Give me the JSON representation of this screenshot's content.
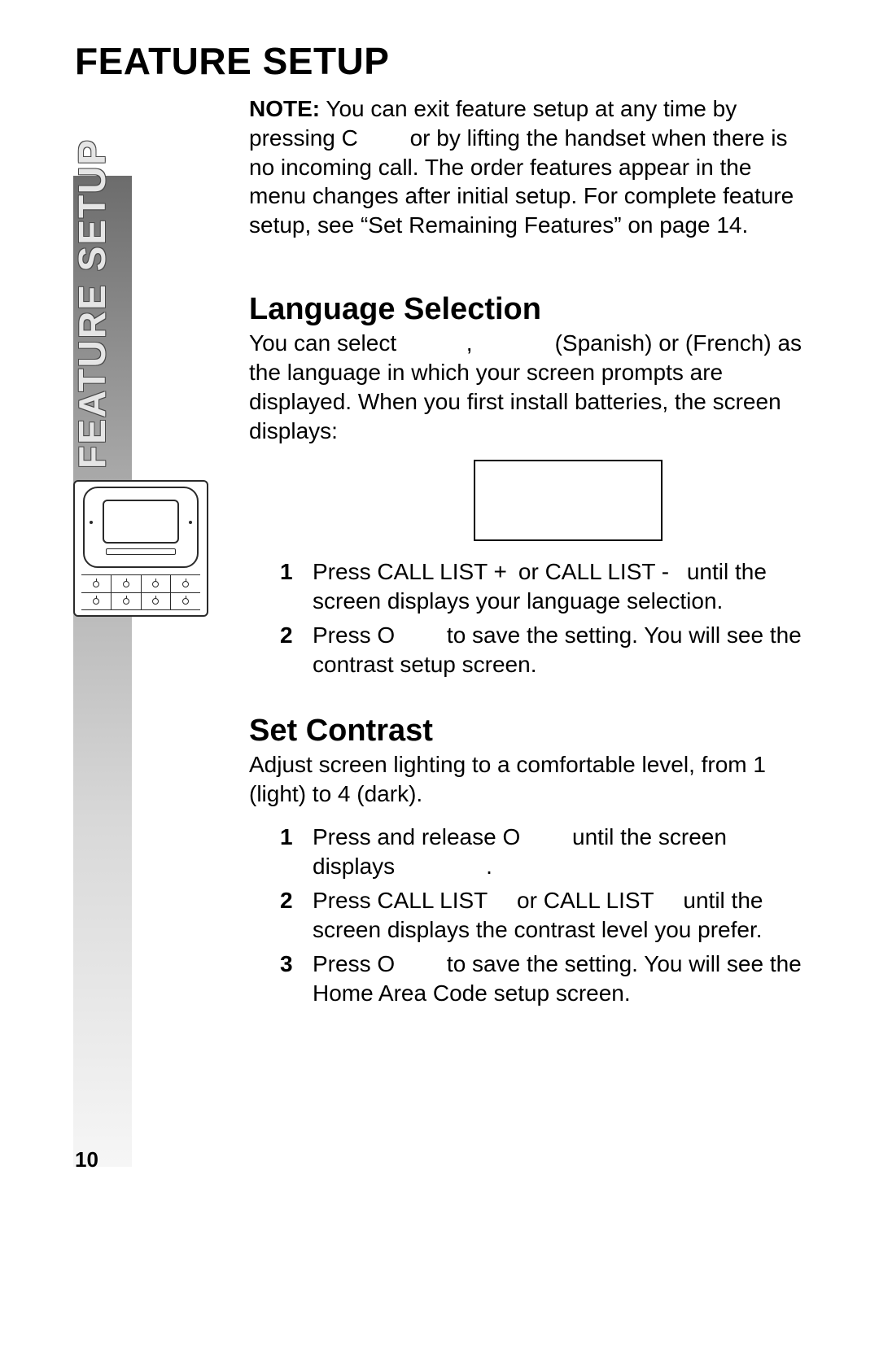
{
  "page_title": "FEATURE SETUP",
  "sidebar_label": "FEATURE SETUP",
  "note": {
    "label": "NOTE:",
    "text": " You can exit feature setup at any time by pressing C   or by lifting the handset when there is no incoming call. The order features appear in the menu changes after initial setup.  For complete feature setup, see “Set Remaining Features” on page 14."
  },
  "sections": [
    {
      "heading": "Language Selection",
      "intro_before": "You can select ",
      "intro_mid1": ", ",
      "intro_mid2": " (Spanish) or ",
      "intro_after": " (French) as the language in which your screen prompts are displayed.  When you first install batteries, the screen displays:",
      "steps": [
        {
          "n": "1",
          "text": "Press CALL LIST + or CALL LIST -  until the screen displays your language selection."
        },
        {
          "n": "2",
          "text": "Press O   to save the setting.  You will see the contrast setup screen."
        }
      ]
    },
    {
      "heading": "Set Contrast",
      "intro": "Adjust screen lighting to a comfortable level, from 1 (light) to 4 (dark).",
      "steps": [
        {
          "n": "1",
          "text": "Press and release O   until the screen displays    ."
        },
        {
          "n": "2",
          "text": "Press CALL LIST  or CALL LIST  until the screen displays the contrast level you prefer."
        },
        {
          "n": "3",
          "text": "Press O   to save the setting.  You will see the Home Area Code setup screen."
        }
      ]
    }
  ],
  "page_number": "10"
}
